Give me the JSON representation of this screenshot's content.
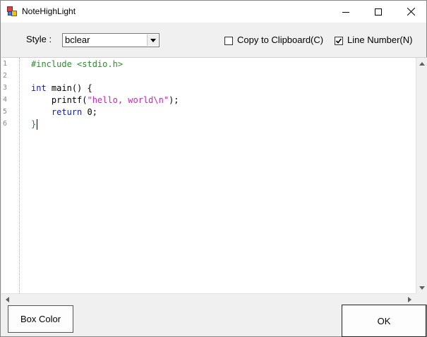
{
  "window": {
    "title": "NoteHighLight",
    "icon": "app-icon"
  },
  "toolbar": {
    "style_label": "Style :",
    "style_value": "bclear",
    "copy_label": "Copy to Clipboard(C)",
    "copy_checked": false,
    "line_number_label": "Line Number(N)",
    "line_number_checked": true
  },
  "editor": {
    "line_numbers": [
      "1",
      "2",
      "3",
      "4",
      "5",
      "6"
    ],
    "lines": [
      {
        "segments": [
          {
            "t": "#include <stdio.h>",
            "k": "pp"
          }
        ]
      },
      {
        "segments": []
      },
      {
        "segments": [
          {
            "t": "int",
            "k": "kw"
          },
          {
            "t": " main",
            "k": "fn"
          },
          {
            "t": "() {",
            "k": "op"
          }
        ]
      },
      {
        "segments": [
          {
            "t": "    printf",
            "k": "fn"
          },
          {
            "t": "(",
            "k": "op"
          },
          {
            "t": "\"hello, world\\n\"",
            "k": "str"
          },
          {
            "t": ");",
            "k": "op"
          }
        ]
      },
      {
        "segments": [
          {
            "t": "    return",
            "k": "kw"
          },
          {
            "t": " 0",
            "k": "num"
          },
          {
            "t": ";",
            "k": "op"
          }
        ]
      },
      {
        "segments": [
          {
            "t": "}",
            "k": "pp"
          }
        ],
        "cursor": true
      }
    ]
  },
  "buttons": {
    "box_color": "Box Color",
    "ok": "OK"
  },
  "colors": {
    "preprocessor": "#2e8b2e",
    "keyword": "#1020b0",
    "string": "#d020c0"
  }
}
